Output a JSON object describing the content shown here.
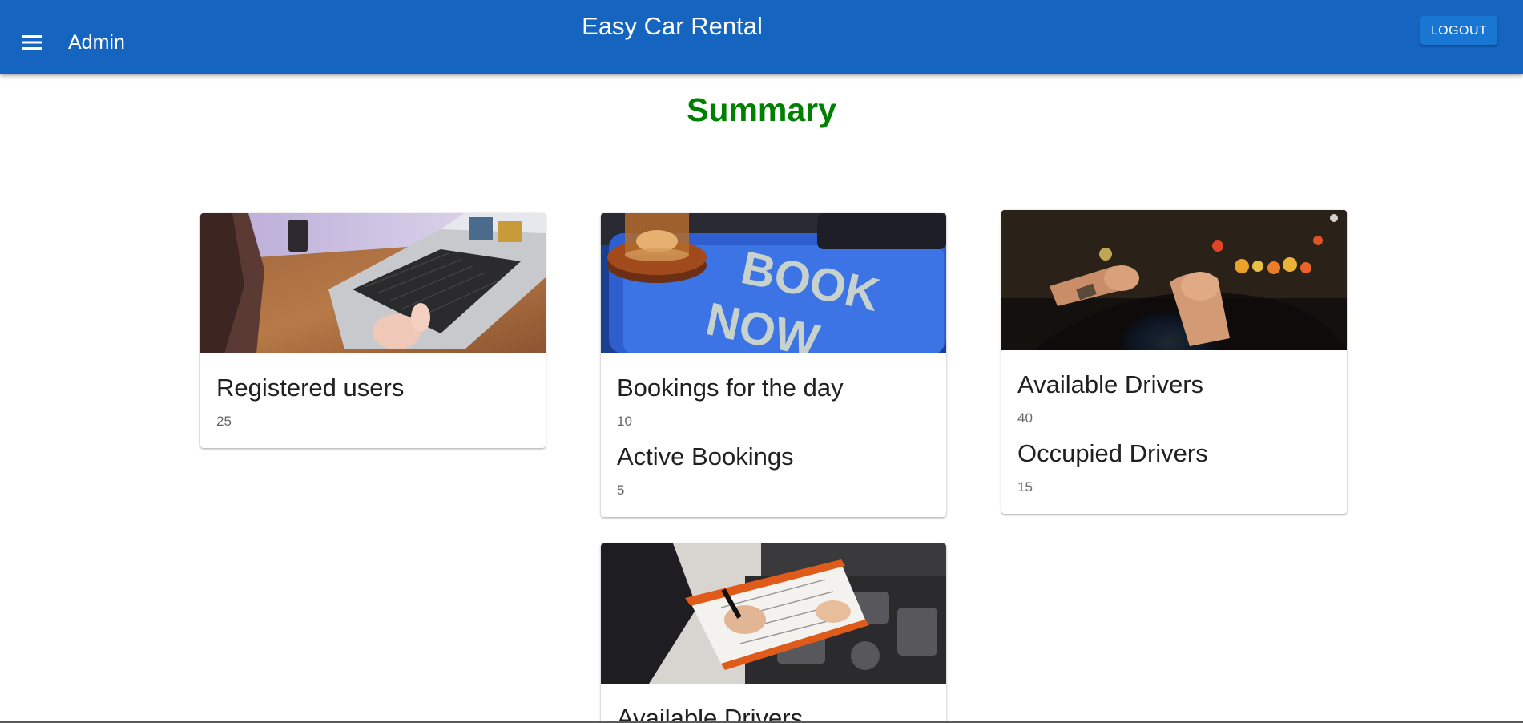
{
  "header": {
    "menu_icon": "menu-icon",
    "role_label": "Admin",
    "app_title": "Easy Car Rental",
    "logout_label": "LOGOUT",
    "bar_color": "#1565c0"
  },
  "summary": {
    "title": "Summary",
    "title_color": "#008000"
  },
  "cards": {
    "registered_users": {
      "image": "laptop-typing-image",
      "stats": [
        {
          "label": "Registered users",
          "value": "25"
        }
      ]
    },
    "bookings": {
      "image": "book-now-bell-image",
      "stats": [
        {
          "label": "Bookings for the day",
          "value": "10"
        },
        {
          "label": "Active Bookings",
          "value": "5"
        }
      ]
    },
    "drivers": {
      "image": "driving-steering-wheel-image",
      "stats": [
        {
          "label": "Available Drivers",
          "value": "40"
        },
        {
          "label": "Occupied Drivers",
          "value": "15"
        }
      ]
    },
    "vehicles": {
      "image": "mechanic-inspection-image",
      "stats": [
        {
          "label": "Available Drivers"
        }
      ]
    }
  }
}
